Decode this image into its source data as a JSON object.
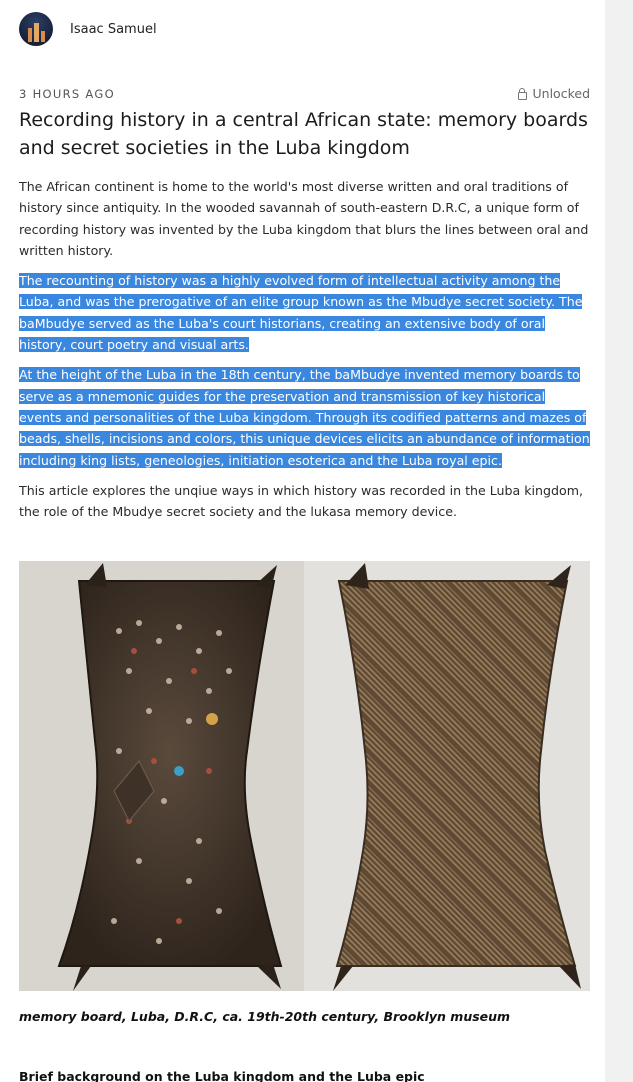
{
  "author": {
    "name": "Isaac Samuel",
    "avatar_icon": "city-skyline-avatar"
  },
  "post": {
    "time": "3 HOURS AGO",
    "status": "Unlocked",
    "status_icon": "lock-icon",
    "title": "Recording history in a central African state: memory boards and secret societies in the Luba kingdom",
    "paragraphs": [
      "The African continent is home to the world's most diverse written and oral traditions of history since antiquity. In the wooded savannah of south-eastern D.R.C, a unique form of recording history was invented by the Luba kingdom that blurs the lines between oral and written history.",
      "The recounting of history was a highly evolved form of intellectual activity among the Luba, and was the prerogative of an elite group known as the Mbudye secret society. The baMbudye served as the Luba's court historians, creating an extensive body of oral history, court poetry and visual arts.",
      "At the height of the Luba in the 18th century, the baMbudye invented memory boards to serve as a mnemonic guides for the preservation and transmission of key historical events and personalities of the Luba kingdom. Through its codified patterns and mazes of beads, shells, incisions and colors, this unique devices elicits an abundance of information including king lists, geneologies, initiation esoterica and the Luba royal epic.",
      "This article explores the unqiue ways in which history was recorded in the Luba kingdom, the role of the Mbudye secret society and the lukasa memory device."
    ],
    "highlighted_paragraphs": [
      1,
      2
    ],
    "figure": {
      "alt_icon": "memory-board-photo"
    },
    "caption": "memory board, Luba, D.R.C, ca. 19th-20th century, Brooklyn museum",
    "subheading": "Brief background on the Luba kingdom and the Luba epic"
  },
  "colors": {
    "highlight": "#3a87e0",
    "card": "#ffffff",
    "page": "#f1f1f1"
  }
}
